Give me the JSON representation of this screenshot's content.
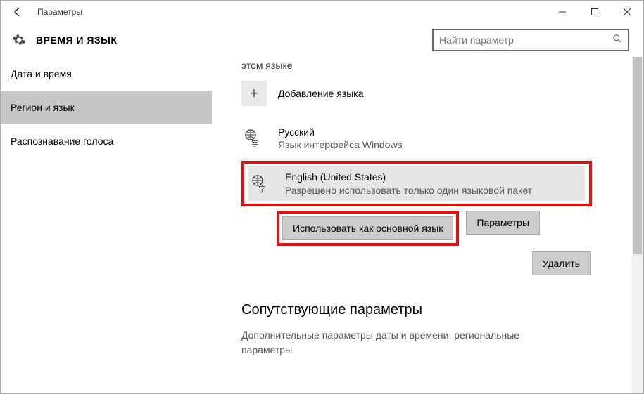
{
  "window": {
    "title": "Параметры"
  },
  "header": {
    "page_title": "ВРЕМЯ И ЯЗЫК"
  },
  "search": {
    "placeholder": "Найти параметр"
  },
  "sidebar": {
    "items": [
      {
        "label": "Дата и время"
      },
      {
        "label": "Регион и язык"
      },
      {
        "label": "Распознавание голоса"
      }
    ]
  },
  "main": {
    "partial_text": "этом языке",
    "add_language": "Добавление языка",
    "languages": [
      {
        "name": "Русский",
        "sub": "Язык интерфейса Windows"
      },
      {
        "name": "English (United States)",
        "sub": "Разрешено использовать только один языковой пакет"
      }
    ],
    "actions": {
      "set_default": "Использовать как основной язык",
      "options": "Параметры",
      "remove": "Удалить"
    },
    "related_heading": "Сопутствующие параметры",
    "related_link": "Дополнительные параметры даты и времени, региональные параметры"
  }
}
